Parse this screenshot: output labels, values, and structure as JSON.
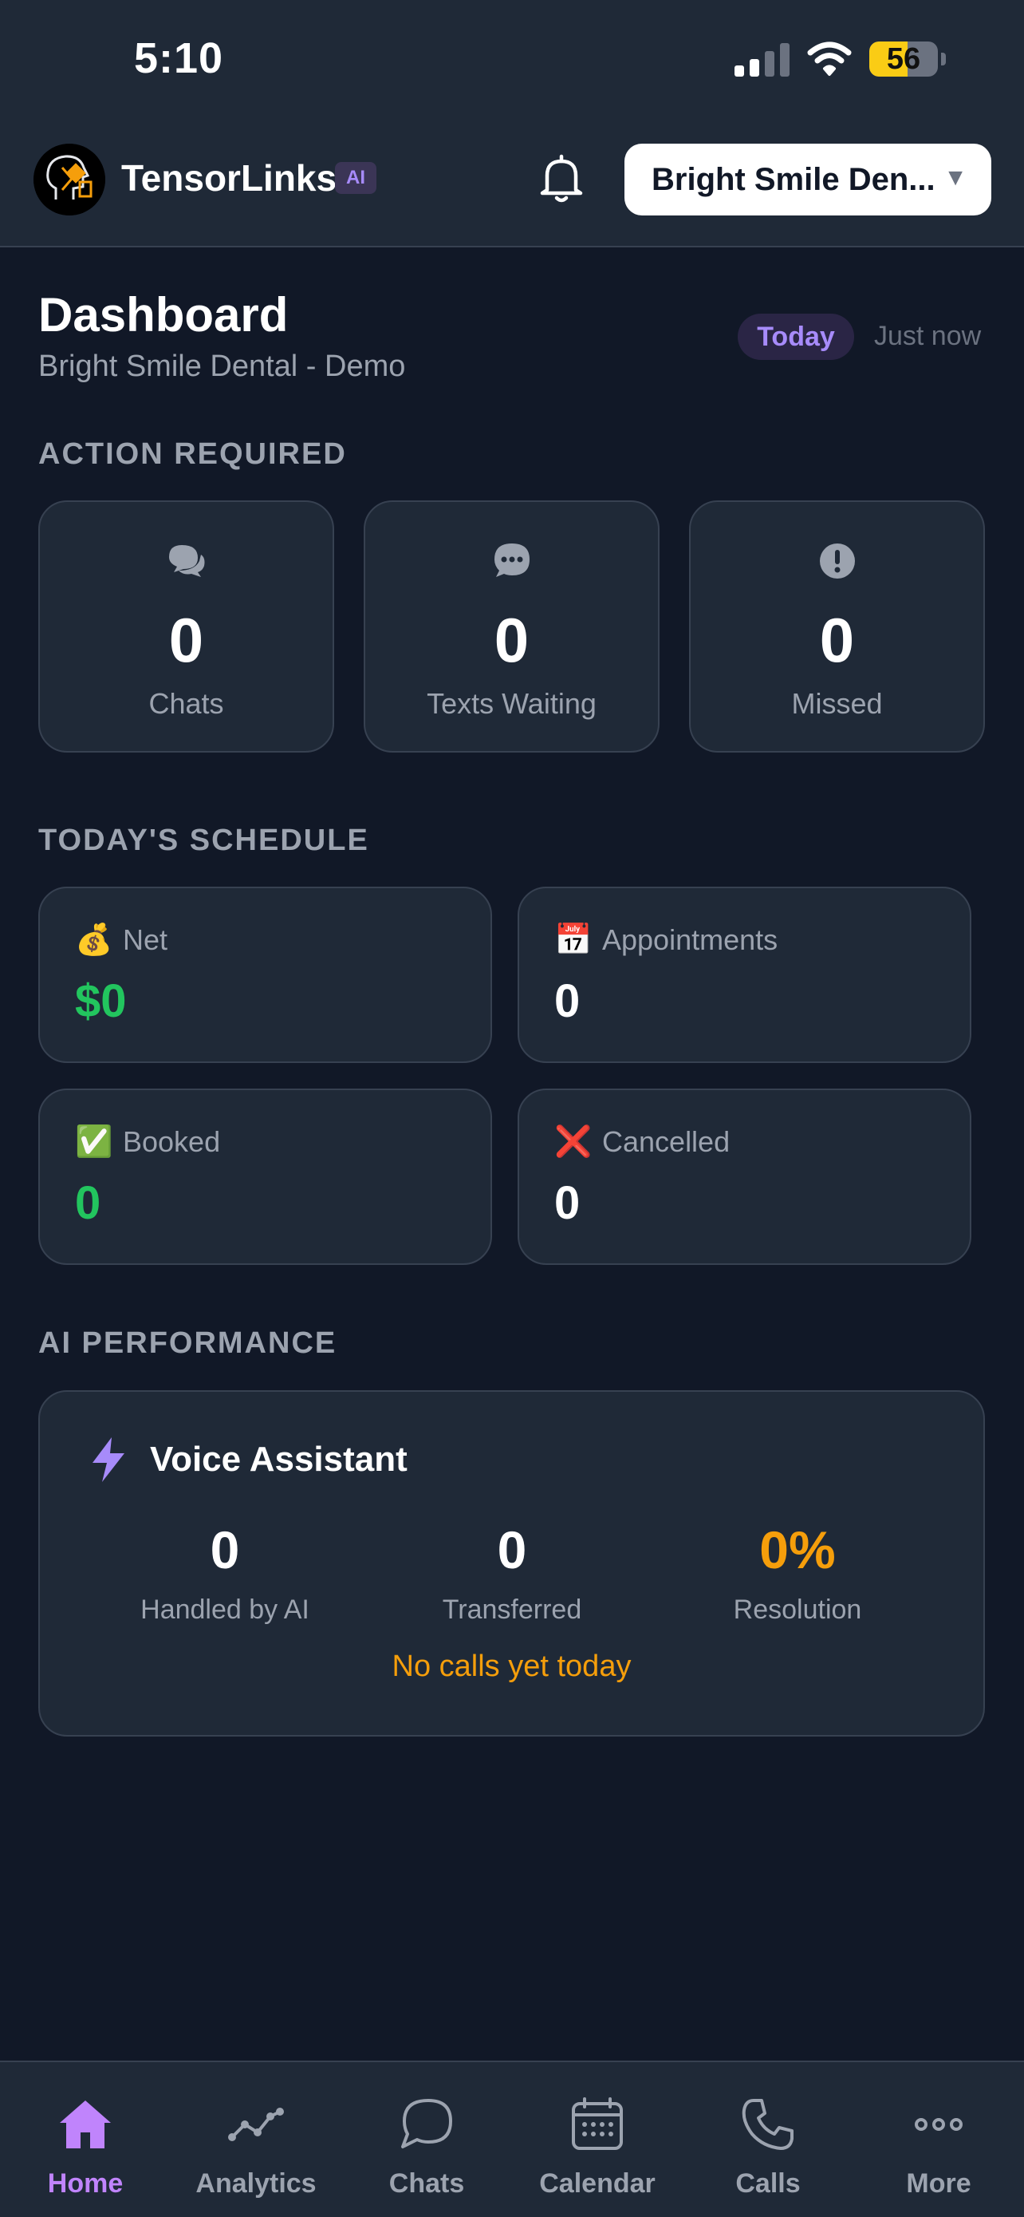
{
  "status_bar": {
    "time": "5:10",
    "battery": 56
  },
  "header": {
    "brand": "TensorLinks",
    "badge": "AI",
    "practice_selected": "Bright Smile Den...",
    "caret": "▼"
  },
  "page": {
    "title": "Dashboard",
    "subtitle": "Bright Smile Dental - Demo",
    "period": "Today",
    "updated": "Just now"
  },
  "action_required": {
    "label": "ACTION REQUIRED",
    "cards": [
      {
        "value": "0",
        "label": "Chats",
        "icon": "chat-bubbles-icon"
      },
      {
        "value": "0",
        "label": "Texts Waiting",
        "icon": "text-message-icon"
      },
      {
        "value": "0",
        "label": "Missed",
        "icon": "alert-icon"
      }
    ]
  },
  "schedule": {
    "label": "TODAY'S SCHEDULE",
    "cards": [
      {
        "emoji": "💰",
        "label": "Net",
        "value": "$0"
      },
      {
        "emoji": "📅",
        "label": "Appointments",
        "value": "0"
      },
      {
        "emoji": "✅",
        "label": "Booked",
        "value": "0"
      },
      {
        "emoji": "❌",
        "label": "Cancelled",
        "value": "0"
      }
    ]
  },
  "ai_performance": {
    "label": "AI PERFORMANCE",
    "title": "Voice Assistant",
    "stats": [
      {
        "value": "0",
        "label": "Handled by AI"
      },
      {
        "value": "0",
        "label": "Transferred"
      },
      {
        "value": "0%",
        "label": "Resolution"
      }
    ],
    "note": "No calls yet today"
  },
  "nav": [
    {
      "label": "Home",
      "icon": "home-icon",
      "active": true
    },
    {
      "label": "Analytics",
      "icon": "analytics-icon",
      "active": false
    },
    {
      "label": "Chats",
      "icon": "chat-icon",
      "active": false
    },
    {
      "label": "Calendar",
      "icon": "calendar-icon",
      "active": false
    },
    {
      "label": "Calls",
      "icon": "phone-icon",
      "active": false
    },
    {
      "label": "More",
      "icon": "more-icon",
      "active": false
    }
  ],
  "colors": {
    "background": "#111827",
    "surface": "#1f2937",
    "accent": "#a78bfa",
    "positive": "#22c55e",
    "warning": "#f59e0b"
  }
}
